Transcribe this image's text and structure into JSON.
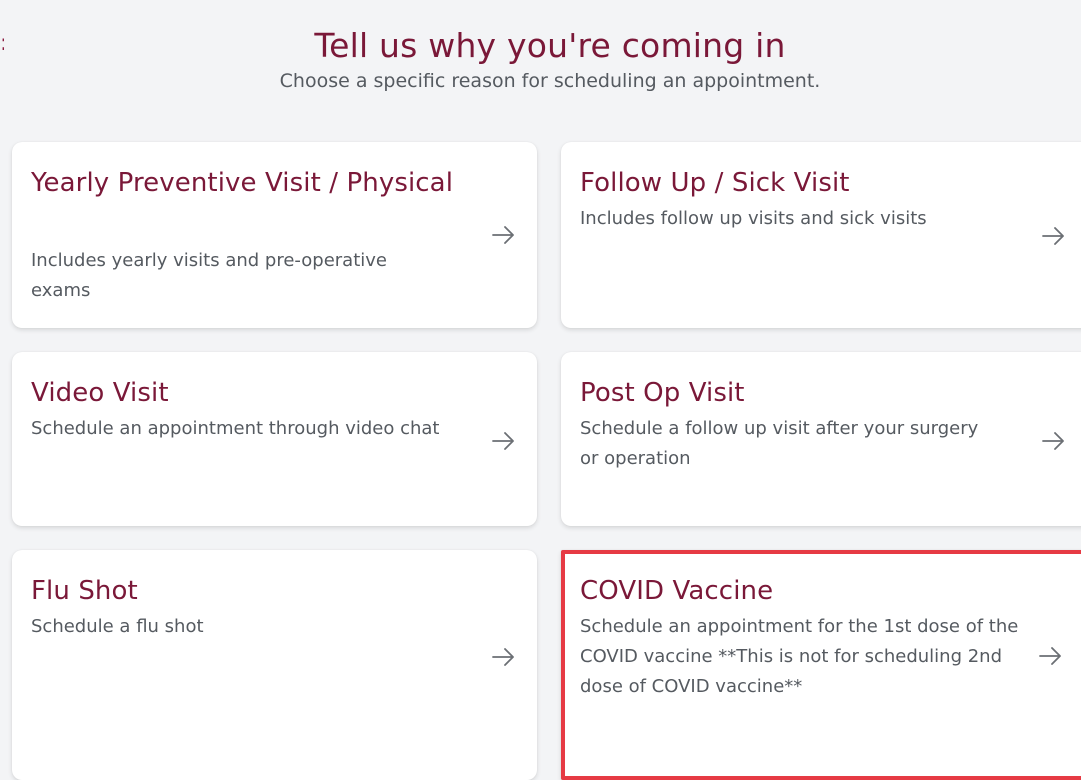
{
  "header": {
    "title": "Tell us why you're coming in",
    "subtitle": "Choose a specific reason for scheduling an appointment."
  },
  "cards": [
    {
      "title": "Yearly Preventive Visit / Physical",
      "description": "Includes yearly visits and pre-operative exams"
    },
    {
      "title": "Follow Up / Sick Visit",
      "description": "Includes follow up visits and sick visits"
    },
    {
      "title": "Video Visit",
      "description": "Schedule an appointment through video chat"
    },
    {
      "title": "Post Op Visit",
      "description": "Schedule a follow up visit after your surgery or operation"
    },
    {
      "title": "Flu Shot",
      "description": "Schedule a flu shot"
    },
    {
      "title": "COVID Vaccine",
      "description": "Schedule an appointment for the 1st dose of the COVID vaccine **This is not for scheduling 2nd dose of COVID vaccine**"
    }
  ],
  "colors": {
    "accent": "#7a1838",
    "text_muted": "#555a60",
    "highlight_border": "#e63a44",
    "background": "#f3f4f6"
  },
  "icons": {
    "arrow": "arrow-right-icon"
  }
}
